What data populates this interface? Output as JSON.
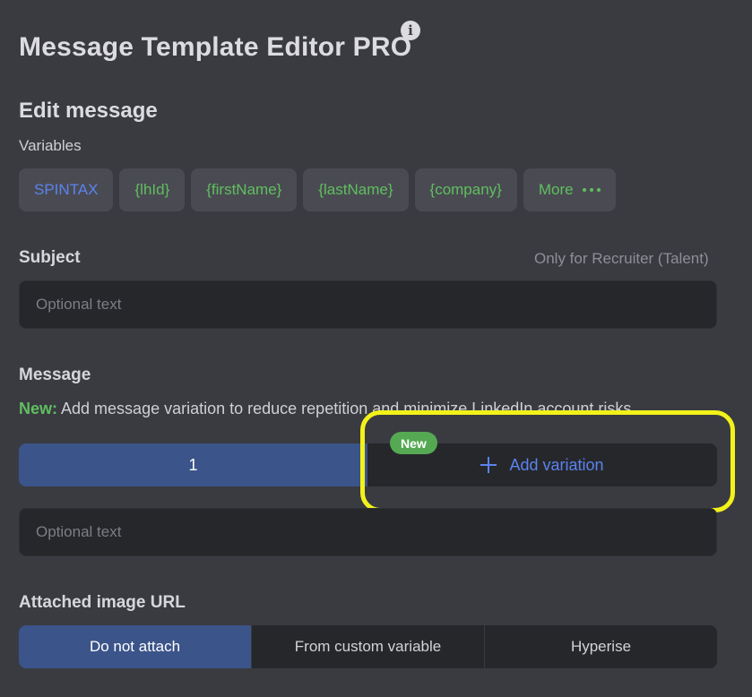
{
  "header": {
    "title": "Message Template Editor PRO",
    "info_icon": "i"
  },
  "edit": {
    "heading": "Edit message",
    "variables_label": "Variables",
    "chips": [
      "SPINTAX",
      "{lhId}",
      "{firstName}",
      "{lastName}",
      "{company}"
    ],
    "more_label": "More"
  },
  "subject": {
    "label": "Subject",
    "note": "Only for Recruiter (Talent)",
    "placeholder": "Optional text"
  },
  "message": {
    "label": "Message",
    "new_prefix": "New:",
    "new_text": " Add message variation to reduce repetition and minimize LinkedIn account risks",
    "variation_tab": "1",
    "add_variation_label": "Add variation",
    "new_badge": "New",
    "placeholder": "Optional text"
  },
  "image": {
    "label": "Attached image URL",
    "options": [
      "Do not attach",
      "From custom variable",
      "Hyperise"
    ],
    "selected": "Do not attach"
  },
  "colors": {
    "background": "#3a3b41",
    "accent_blue": "#5b83ef",
    "accent_green": "#5fbf5f",
    "selected_tab": "#3b5489",
    "highlight": "#f2f21a"
  }
}
